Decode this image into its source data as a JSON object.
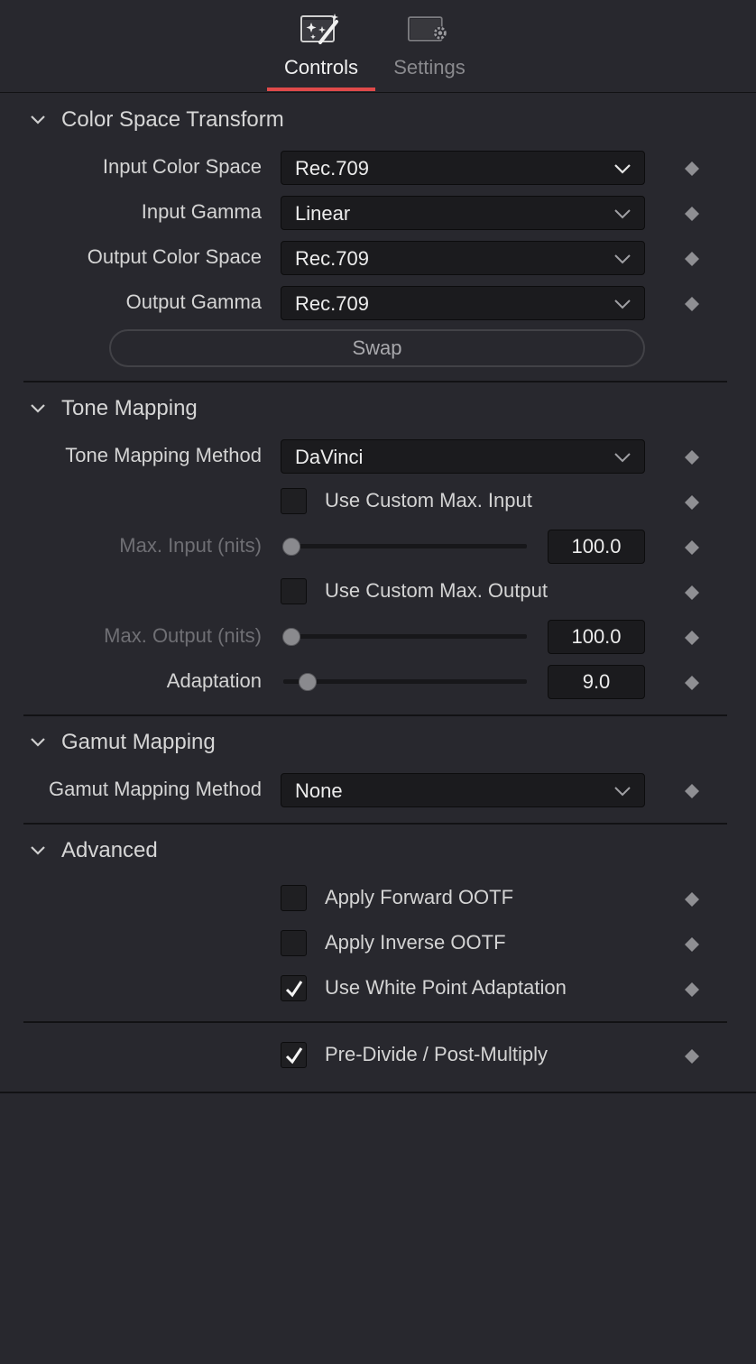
{
  "tabs": {
    "controls": "Controls",
    "settings": "Settings"
  },
  "colorSpaceTransform": {
    "title": "Color Space Transform",
    "inputColorSpace": {
      "label": "Input Color Space",
      "value": "Rec.709"
    },
    "inputGamma": {
      "label": "Input Gamma",
      "value": "Linear"
    },
    "outputColorSpace": {
      "label": "Output Color Space",
      "value": "Rec.709"
    },
    "outputGamma": {
      "label": "Output Gamma",
      "value": "Rec.709"
    },
    "swap": "Swap"
  },
  "toneMapping": {
    "title": "Tone Mapping",
    "method": {
      "label": "Tone Mapping Method",
      "value": "DaVinci"
    },
    "useCustomMaxInput": {
      "label": "Use Custom Max. Input",
      "checked": false
    },
    "maxInput": {
      "label": "Max. Input (nits)",
      "value": "100.0",
      "slider": 0.0
    },
    "useCustomMaxOutput": {
      "label": "Use Custom Max. Output",
      "checked": false
    },
    "maxOutput": {
      "label": "Max. Output (nits)",
      "value": "100.0",
      "slider": 0.0
    },
    "adaptation": {
      "label": "Adaptation",
      "value": "9.0",
      "slider": 0.09
    }
  },
  "gamutMapping": {
    "title": "Gamut Mapping",
    "method": {
      "label": "Gamut Mapping Method",
      "value": "None"
    }
  },
  "advanced": {
    "title": "Advanced",
    "applyForwardOOTF": {
      "label": "Apply Forward OOTF",
      "checked": false
    },
    "applyInverseOOTF": {
      "label": "Apply Inverse OOTF",
      "checked": false
    },
    "useWhitePointAdaptation": {
      "label": "Use White Point Adaptation",
      "checked": true
    }
  },
  "preDividePostMultiply": {
    "label": "Pre-Divide / Post-Multiply",
    "checked": true
  }
}
